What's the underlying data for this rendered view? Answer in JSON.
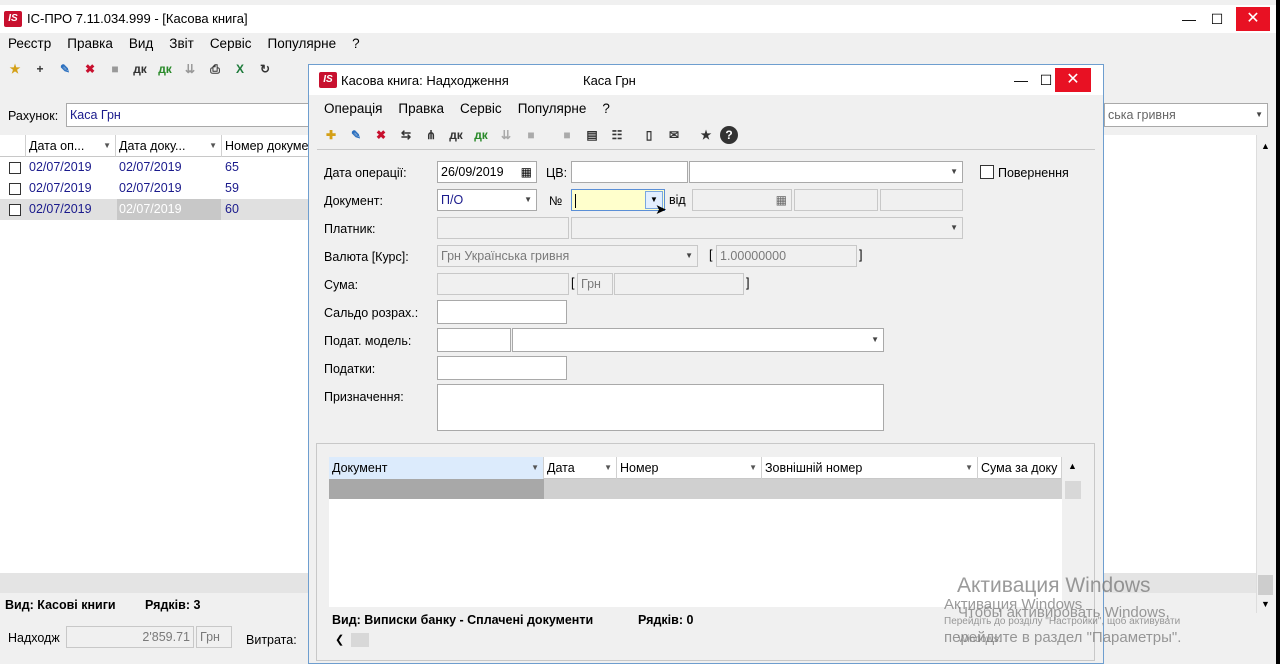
{
  "main": {
    "title": "ІС-ПРО 7.11.034.999 - [Касова книга]",
    "logo": "IS",
    "menu": [
      "Реєстр",
      "Правка",
      "Вид",
      "Звіт",
      "Сервіс",
      "Популярне",
      "?"
    ],
    "account_label": "Рахунок:",
    "account_value": "Каса Грн",
    "currency_right": "ська гривня",
    "columns": [
      "Дата оп...",
      "Дата доку...",
      "Номер докуме"
    ],
    "rows": [
      {
        "date_op": "02/07/2019",
        "date_doc": "02/07/2019",
        "num": "65"
      },
      {
        "date_op": "02/07/2019",
        "date_doc": "02/07/2019",
        "num": "59"
      },
      {
        "date_op": "02/07/2019",
        "date_doc": "02/07/2019",
        "num": "60"
      }
    ],
    "status_view": "Вид: Касові книги",
    "status_rows": "Рядків: 3",
    "income_label": "Надходж",
    "income_value": "2'859.71",
    "income_currency": "Грн",
    "expense_label": "Витрата:"
  },
  "dialog": {
    "logo": "IS",
    "title": "Касова книга: Надходження",
    "title_account": "Каса Грн",
    "menu": [
      "Операція",
      "Правка",
      "Сервіс",
      "Популярне",
      "?"
    ],
    "labels": {
      "date_op": "Дата операції:",
      "cb": "ЦВ:",
      "return": "Повернення",
      "document": "Документ:",
      "number": "№",
      "from": "від",
      "payer": "Платник:",
      "currency": "Валюта [Курс]:",
      "sum": "Сума:",
      "balance": "Сальдо розрах.:",
      "tax_model": "Подат. модель:",
      "taxes": "Податки:",
      "purpose": "Призначення:"
    },
    "values": {
      "date_op": "26/09/2019",
      "document": "П/О",
      "currency": "Грн Українська гривня",
      "rate": "1.00000000",
      "sum_currency": "Грн",
      "bracket_open": "[",
      "bracket_close": "]"
    },
    "grid_columns": [
      "Документ",
      "Дата",
      "Номер",
      "Зовнішній номер",
      "Сума за доку"
    ],
    "status_view": "Вид: Виписки банку - Сплачені документи",
    "status_rows": "Рядків: 0"
  },
  "watermark": {
    "title": "Активация Windows",
    "title2": "Активация Windows",
    "line1": "Чтобы активировать Windows,",
    "line2": "Перейдіть до розділу \"Настройки\", щоб активувати",
    "line3": "перейдите в раздел \"Параметры\".",
    "line4": "Windows."
  },
  "colors": {
    "accent": "#1a1a8c",
    "close": "#e81123",
    "logo": "#c8102e",
    "selection": "#c8c8c8",
    "number_highlight": "#ffffcc"
  }
}
